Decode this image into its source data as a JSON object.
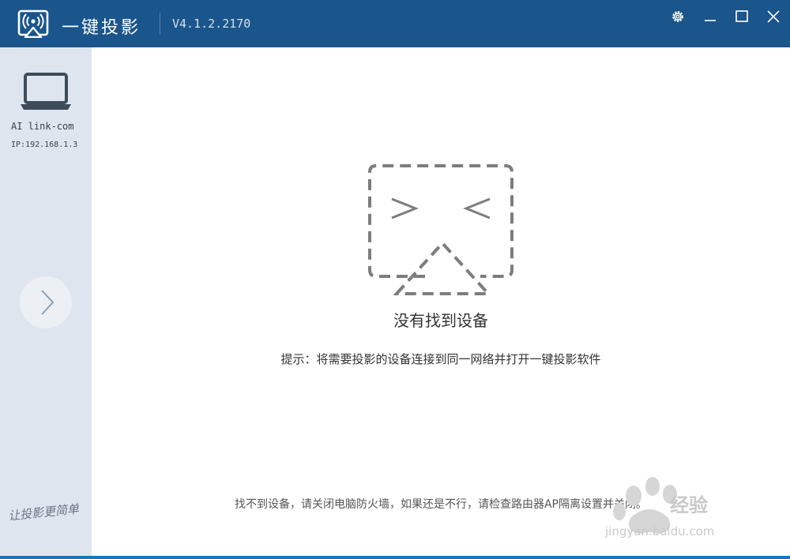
{
  "window": {
    "app_title": "一键投影",
    "version": "V4.1.2.2170",
    "icons": [
      "cast-logo-icon",
      "gear-icon",
      "minimize-icon",
      "maximize-icon",
      "close-icon"
    ]
  },
  "sidebar": {
    "device": {
      "icon": "laptop-icon",
      "name": "AI link-com",
      "ip": "IP:192.168.1.3"
    },
    "next_icon": "chevron-right-icon",
    "slogan": "让投影更简单"
  },
  "main": {
    "empty_title": "没有找到设备",
    "tip": "提示：将需要投影的设备连接到同一网络并打开一键投影软件",
    "bottom_hint": "找不到设备，请关闭电脑防火墙，如果还是不行，请检查路由器AP隔离设置并关闭。"
  },
  "watermark": {
    "brand": "经验",
    "url": "jingyan.baidu.com"
  },
  "colors": {
    "titlebar": "#1a558c",
    "sidebar": "#dfe5ee",
    "accent": "#1f73b8"
  }
}
